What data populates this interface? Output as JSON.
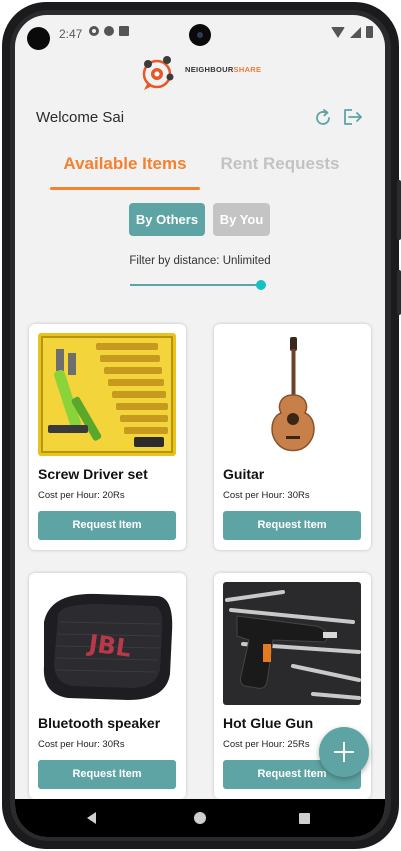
{
  "status_bar": {
    "time": "2:47",
    "left_icons": [
      "gear-icon",
      "a-badge-icon",
      "sd-card-icon"
    ],
    "right_icons": [
      "wifi-icon",
      "signal-icon",
      "battery-icon"
    ]
  },
  "header": {
    "logo_text_main": "NEIGHBOUR",
    "logo_text_accent": "SHARE",
    "welcome": "Welcome Sai"
  },
  "tabs": [
    {
      "label": "Available Items",
      "active": true
    },
    {
      "label": "Rent Requests",
      "active": false
    }
  ],
  "filters": {
    "by_others": "By Others",
    "by_you": "By You",
    "distance_label": "Filter by distance: Unlimited",
    "distance_slider_value": 1.0
  },
  "items": [
    {
      "name": "Screw Driver set",
      "cost": "Cost per Hour:  20Rs",
      "button": "Request Item",
      "image": "screwdriver-set-image"
    },
    {
      "name": "Guitar",
      "cost": "Cost per Hour:  30Rs",
      "button": "Request Item",
      "image": "guitar-image"
    },
    {
      "name": "Bluetooth speaker",
      "cost": "Cost per Hour:  30Rs",
      "button": "Request Item",
      "image": "bluetooth-speaker-image"
    },
    {
      "name": "Hot Glue Gun",
      "cost": "Cost per Hour:  25Rs",
      "button": "Request Item",
      "image": "glue-gun-image"
    }
  ],
  "speaker_brand": "JBL",
  "fab": {
    "icon": "plus-icon"
  },
  "nav": [
    "back-icon",
    "home-icon",
    "recents-icon"
  ],
  "colors": {
    "accent_orange": "#f5812f",
    "teal": "#5ea4a4",
    "slider_thumb": "#16c1c4",
    "inactive_gray": "#c4c4c4",
    "background": "#f2f2f2"
  }
}
